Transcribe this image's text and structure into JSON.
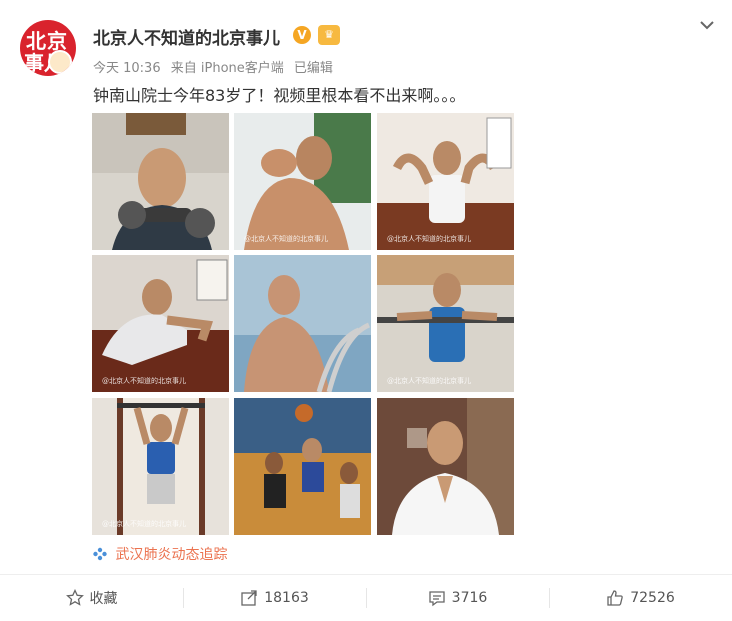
{
  "header": {
    "account_name": "北京人不知道的北京事儿",
    "avatar_text_top": "北京",
    "avatar_text_bottom": "事儿",
    "verified_badge": "V",
    "time": "今天 10:36",
    "source": "来自 iPhone客户端",
    "edited": "已编辑"
  },
  "post": {
    "text": "钟南山院士今年83岁了！视频里根本看不出来啊。。。"
  },
  "photos": [
    {
      "watermark": ""
    },
    {
      "watermark": "@北京人不知道的北京事儿"
    },
    {
      "watermark": "@北京人不知道的北京事儿"
    },
    {
      "watermark": "@北京人不知道的北京事儿"
    },
    {
      "watermark": ""
    },
    {
      "watermark": "@北京人不知道的北京事儿"
    },
    {
      "watermark": "@北京人不知道的北京事儿"
    },
    {
      "watermark": ""
    },
    {
      "watermark": ""
    }
  ],
  "topic": {
    "label": "武汉肺炎动态追踪",
    "icon": "topic-icon"
  },
  "actions": {
    "favorite": "收藏",
    "repost_count": "18163",
    "comment_count": "3716",
    "like_count": "72526"
  },
  "colors": {
    "brand_red": "#d9232d",
    "topic": "#eb7350",
    "text": "#333333",
    "meta": "#888888"
  }
}
